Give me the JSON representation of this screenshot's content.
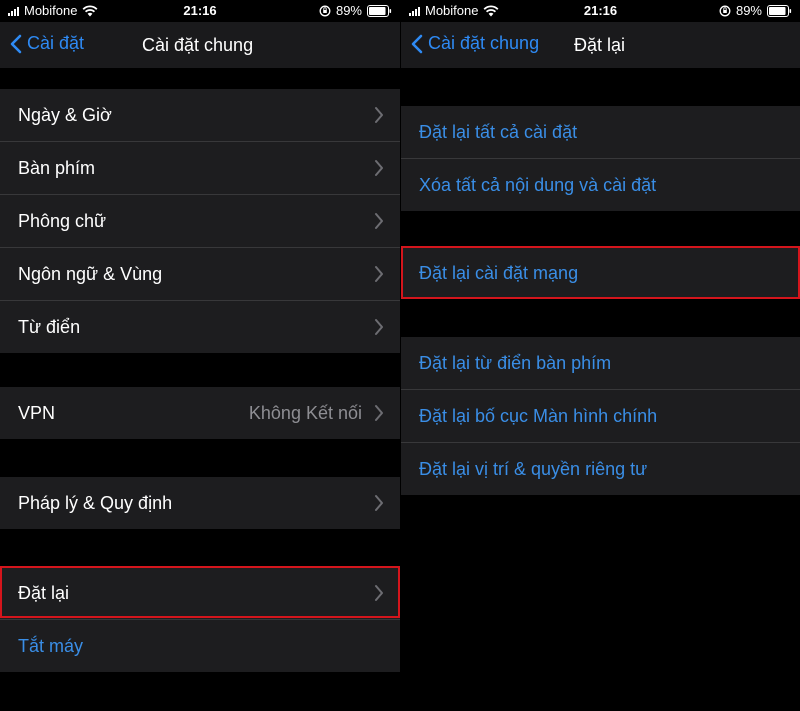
{
  "left": {
    "status": {
      "carrier": "Mobifone",
      "time": "21:16",
      "battery": "89%"
    },
    "nav": {
      "back": "Cài đặt",
      "title": "Cài đặt chung"
    },
    "group1": [
      "Ngày & Giờ",
      "Bàn phím",
      "Phông chữ",
      "Ngôn ngữ & Vùng",
      "Từ điển"
    ],
    "vpn": {
      "label": "VPN",
      "value": "Không Kết nối"
    },
    "legal": "Pháp lý & Quy định",
    "reset": "Đặt lại",
    "shutdown": "Tắt máy"
  },
  "right": {
    "status": {
      "carrier": "Mobifone",
      "time": "21:16",
      "battery": "89%"
    },
    "nav": {
      "back": "Cài đặt chung",
      "title": "Đặt lại"
    },
    "group1": [
      "Đặt lại tất cả cài đặt",
      "Xóa tất cả nội dung và cài đặt"
    ],
    "network": "Đặt lại cài đặt mạng",
    "group3": [
      "Đặt lại từ điển bàn phím",
      "Đặt lại bố cục Màn hình chính",
      "Đặt lại vị trí & quyền riêng tư"
    ]
  },
  "colors": {
    "accent": "#3a8ee6",
    "highlight": "#d4151c",
    "cell": "#1d1d1f",
    "separator": "#38383a"
  },
  "icons": [
    "signal-icon",
    "wifi-icon",
    "orientation-lock-icon",
    "battery-icon",
    "back-chevron-icon",
    "chevron-right-icon"
  ]
}
